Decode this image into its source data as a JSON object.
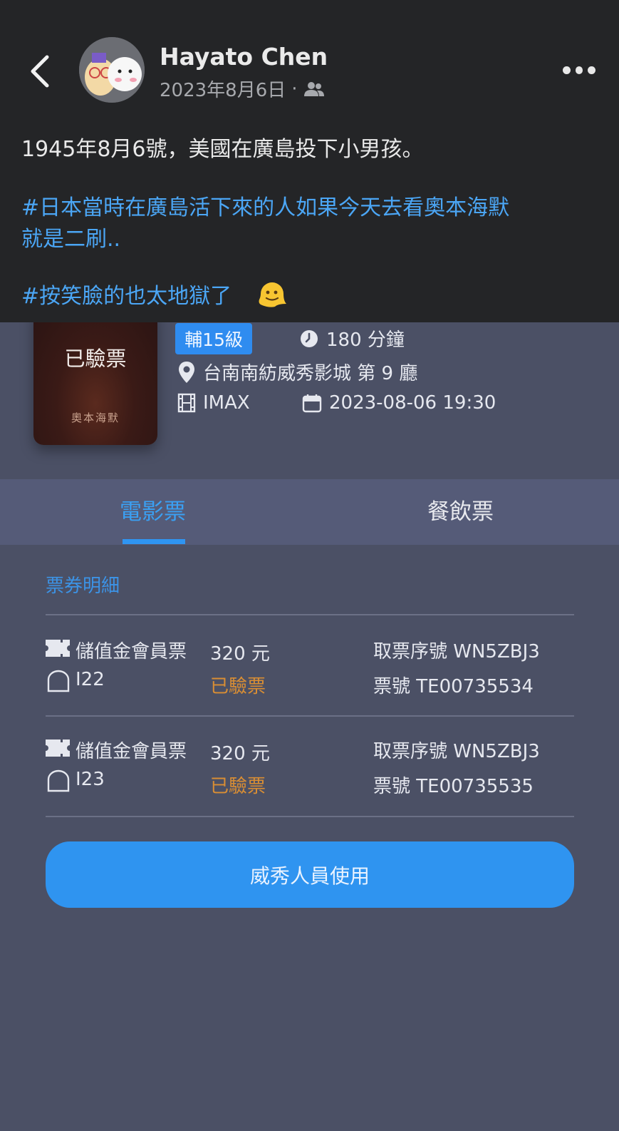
{
  "post": {
    "author": "Hayato Chen",
    "date": "2023年8月6日",
    "separator": "·",
    "body_line1": "1945年8月6號，美國在廣島投下小男孩。",
    "hashtag1_line1": "#日本當時在廣島活下來的人如果今天去看奧本海默",
    "hashtag1_line2": "就是二刷..",
    "hashtag2": "#按笑臉的也太地獄了"
  },
  "movie": {
    "poster_stamp": "已驗票",
    "poster_title": "奧本海默",
    "rating": "輔15級",
    "duration": "180 分鐘",
    "cinema": "台南南紡威秀影城 第 9 廳",
    "format": "IMAX",
    "datetime": "2023-08-06 19:30"
  },
  "tabs": {
    "movie_ticket": "電影票",
    "food_ticket": "餐飲票"
  },
  "ticket_details": {
    "title": "票券明細",
    "items": [
      {
        "type": "儲值金會員票",
        "seat": "I22",
        "price": "320 元",
        "status": "已驗票",
        "pickup_code": "取票序號 WN5ZBJ3",
        "ticket_no": "票號 TE00735534"
      },
      {
        "type": "儲值金會員票",
        "seat": "I23",
        "price": "320 元",
        "status": "已驗票",
        "pickup_code": "取票序號 WN5ZBJ3",
        "ticket_no": "票號 TE00735535"
      }
    ]
  },
  "staff_button": "威秀人員使用",
  "icons": {
    "back": "chevron-left-icon",
    "audience": "friends-icon",
    "more": "more-horizontal-icon",
    "emoji": "melting-face-icon",
    "clock": "clock-icon",
    "location": "location-pin-icon",
    "film": "film-icon",
    "calendar": "calendar-icon",
    "ticket": "ticket-icon",
    "seat": "seat-icon"
  },
  "colors": {
    "accent": "#2f94f0",
    "status_verified": "#d98e34",
    "background": "#4b5065",
    "post_background": "#242527"
  }
}
